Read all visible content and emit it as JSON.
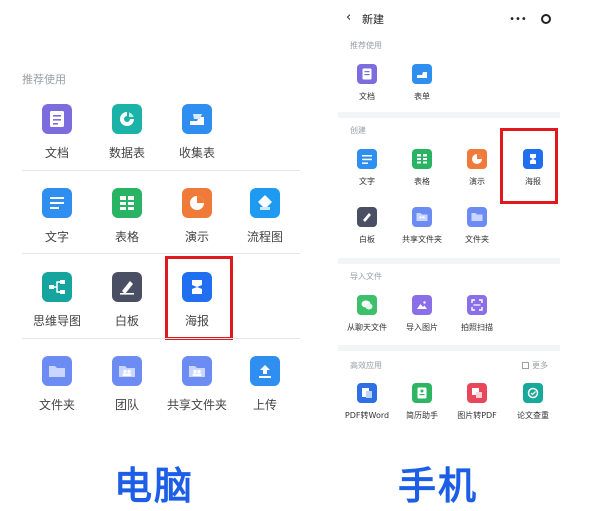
{
  "desktop": {
    "section_label": "推荐使用",
    "items": [
      {
        "label": "文档",
        "icon": "doc-icon",
        "color": "#7c6cde"
      },
      {
        "label": "数据表",
        "icon": "database-icon",
        "color": "#1bb3a8"
      },
      {
        "label": "收集表",
        "icon": "form-icon",
        "color": "#2f8ff0"
      },
      {
        "label": "文字",
        "icon": "text-icon",
        "color": "#2f8ff0"
      },
      {
        "label": "表格",
        "icon": "table-icon",
        "color": "#28b463"
      },
      {
        "label": "演示",
        "icon": "slides-icon",
        "color": "#f07a3a"
      },
      {
        "label": "流程图",
        "icon": "flowchart-icon",
        "color": "#1e9bf0"
      },
      {
        "label": "思维导图",
        "icon": "mindmap-icon",
        "color": "#15a59e"
      },
      {
        "label": "白板",
        "icon": "whiteboard-icon",
        "color": "#4a4f63"
      },
      {
        "label": "海报",
        "icon": "poster-icon",
        "color": "#1f6ff0"
      },
      {
        "label": "文件夹",
        "icon": "folder-icon",
        "color": "#6d8cf3"
      },
      {
        "label": "团队",
        "icon": "team-icon",
        "color": "#6d8cf3"
      },
      {
        "label": "共享文件夹",
        "icon": "shared-folder-icon",
        "color": "#6d8cf3"
      },
      {
        "label": "上传",
        "icon": "upload-icon",
        "color": "#2f8ff0"
      }
    ],
    "caption": "电脑"
  },
  "mobile": {
    "title": "新建",
    "sections": {
      "recommended": "推荐使用",
      "create": "创建",
      "import": "导入文件",
      "efficiency": "高效应用",
      "more": "更多"
    },
    "items": [
      {
        "label": "文档",
        "icon": "doc-icon",
        "color": "#7c6cde"
      },
      {
        "label": "表单",
        "icon": "form-icon",
        "color": "#2f8ff0"
      },
      {
        "label": "文字",
        "icon": "text-icon",
        "color": "#2f8ff0"
      },
      {
        "label": "表格",
        "icon": "table-icon",
        "color": "#28b463"
      },
      {
        "label": "演示",
        "icon": "slides-icon",
        "color": "#f07a3a"
      },
      {
        "label": "海报",
        "icon": "poster-icon",
        "color": "#1f6ff0"
      },
      {
        "label": "白板",
        "icon": "whiteboard-icon",
        "color": "#4a4f63"
      },
      {
        "label": "共享文件夹",
        "icon": "shared-folder-icon",
        "color": "#6d8cf3"
      },
      {
        "label": "文件夹",
        "icon": "folder-icon",
        "color": "#6d8cf3"
      },
      {
        "label": "从聊天文件",
        "icon": "chat-icon",
        "color": "#3cc06a"
      },
      {
        "label": "导入图片",
        "icon": "image-icon",
        "color": "#8a6fe8"
      },
      {
        "label": "拍照扫描",
        "icon": "scan-icon",
        "color": "#8a6fe8"
      },
      {
        "label": "PDF转Word",
        "icon": "pdf-word-icon",
        "color": "#2f6fe6"
      },
      {
        "label": "简历助手",
        "icon": "resume-icon",
        "color": "#2eb462"
      },
      {
        "label": "图片转PDF",
        "icon": "image-pdf-icon",
        "color": "#e8465a"
      },
      {
        "label": "论文查重",
        "icon": "paper-check-icon",
        "color": "#18a89c"
      }
    ],
    "caption": "手机"
  },
  "colors": {
    "highlight": "#e0191e",
    "caption": "#1d5ee6"
  }
}
